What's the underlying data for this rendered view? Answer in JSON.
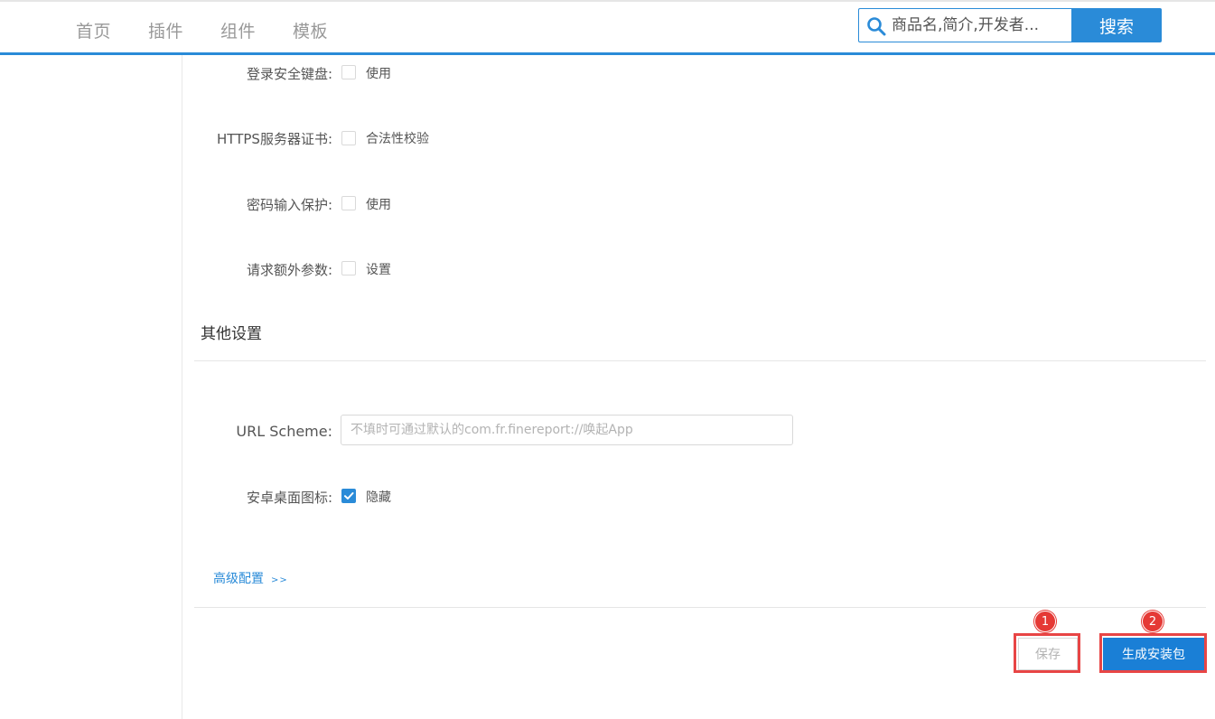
{
  "nav": {
    "items": [
      "首页",
      "插件",
      "组件",
      "模板"
    ]
  },
  "search": {
    "placeholder": "商品名,简介,开发者...",
    "button_label": "搜索"
  },
  "security": {
    "rows": [
      {
        "label": "登录安全键盘:",
        "option": "使用",
        "checked": false
      },
      {
        "label": "HTTPS服务器证书:",
        "option": "合法性校验",
        "checked": false
      },
      {
        "label": "密码输入保护:",
        "option": "使用",
        "checked": false
      },
      {
        "label": "请求额外参数:",
        "option": "设置",
        "checked": false
      }
    ]
  },
  "other": {
    "section_title": "其他设置",
    "url_scheme_label": "URL Scheme:",
    "url_scheme_placeholder": "不填时可通过默认的com.fr.finereport://唤起App",
    "url_scheme_value": "",
    "desktop_icon_label": "安卓桌面图标:",
    "desktop_icon_option": "隐藏",
    "desktop_icon_checked": true
  },
  "advanced": {
    "label": "高级配置",
    "arrows": ">>"
  },
  "actions": {
    "save_label": "保存",
    "build_label": "生成安装包",
    "badge_1": "1",
    "badge_2": "2"
  },
  "colors": {
    "accent": "#2a8bd8",
    "annotation": "#e53935"
  }
}
